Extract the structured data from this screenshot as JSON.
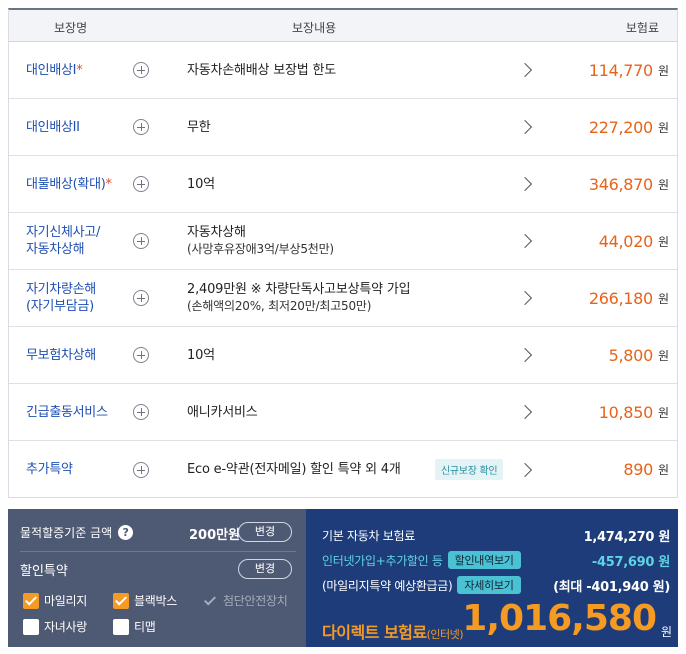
{
  "table": {
    "headers": {
      "name": "보장명",
      "content": "보장내용",
      "premium": "보험료"
    },
    "rows": [
      {
        "name1": "대인배상I",
        "name2": "",
        "star": "*",
        "content1": "자동차손해배상 보장법 한도",
        "content2": "",
        "badge": "",
        "premium": "114,770",
        "won": "원"
      },
      {
        "name1": "대인배상II",
        "name2": "",
        "star": "",
        "content1": "무한",
        "content2": "",
        "badge": "",
        "premium": "227,200",
        "won": "원"
      },
      {
        "name1": "대물배상(확대)",
        "name2": "",
        "star": "*",
        "content1": "10억",
        "content2": "",
        "badge": "",
        "premium": "346,870",
        "won": "원"
      },
      {
        "name1": "자기신체사고/",
        "name2": "자동차상해",
        "star": "",
        "content1": "자동차상해",
        "content2": "(사망후유장애3억/부상5천만)",
        "badge": "",
        "premium": "44,020",
        "won": "원"
      },
      {
        "name1": "자기차량손해",
        "name2": "(자기부담금)",
        "star": "",
        "content1": "2,409만원 ※ 차량단독사고보상특약 가입",
        "content2": "(손해액의20%, 최저20만/최고50만)",
        "badge": "",
        "premium": "266,180",
        "won": "원"
      },
      {
        "name1": "무보험차상해",
        "name2": "",
        "star": "",
        "content1": "10억",
        "content2": "",
        "badge": "",
        "premium": "5,800",
        "won": "원"
      },
      {
        "name1": "긴급출동서비스",
        "name2": "",
        "star": "",
        "content1": "애니카서비스",
        "content2": "",
        "badge": "",
        "premium": "10,850",
        "won": "원"
      },
      {
        "name1": "추가특약",
        "name2": "",
        "star": "",
        "content1": "Eco e-약관(전자메일) 할인 특약 외 4개",
        "content2": "",
        "badge": "신규보장 확인",
        "premium": "890",
        "won": "원"
      }
    ]
  },
  "options": {
    "property_label": "물적할증기준 금액",
    "property_amount": "200만원",
    "change_label": "변경",
    "discount_label": "할인특약",
    "discount_change_label": "변경",
    "discounts": [
      {
        "label": "마일리지",
        "state": "checked"
      },
      {
        "label": "블랙박스",
        "state": "checked"
      },
      {
        "label": "첨단안전장치",
        "state": "disabled"
      },
      {
        "label": "자녀사랑",
        "state": "unchecked"
      },
      {
        "label": "티맵",
        "state": "unchecked"
      }
    ]
  },
  "summary": {
    "base_label": "기본 자동차 보험료",
    "base_value": "1,474,270 원",
    "internet_label": "인터넷가입+추가할인 등",
    "internet_btn": "할인내역보기",
    "internet_value": "-457,690 원",
    "mileage_label": "(마일리지특약 예상환급금)",
    "mileage_btn": "자세히보기",
    "mileage_value": "(최대 -401,940 원)",
    "direct_label": "다이렉트 보험료",
    "direct_suffix": "(인터넷)",
    "direct_amount": "1,016,580",
    "direct_won": "원"
  },
  "colors": {
    "accent": "#e8631a",
    "link": "#1f4fb3",
    "navy": "#1d3c79",
    "slate": "#4e5a73",
    "orange": "#f59a23",
    "teal": "#5fd3e3"
  }
}
